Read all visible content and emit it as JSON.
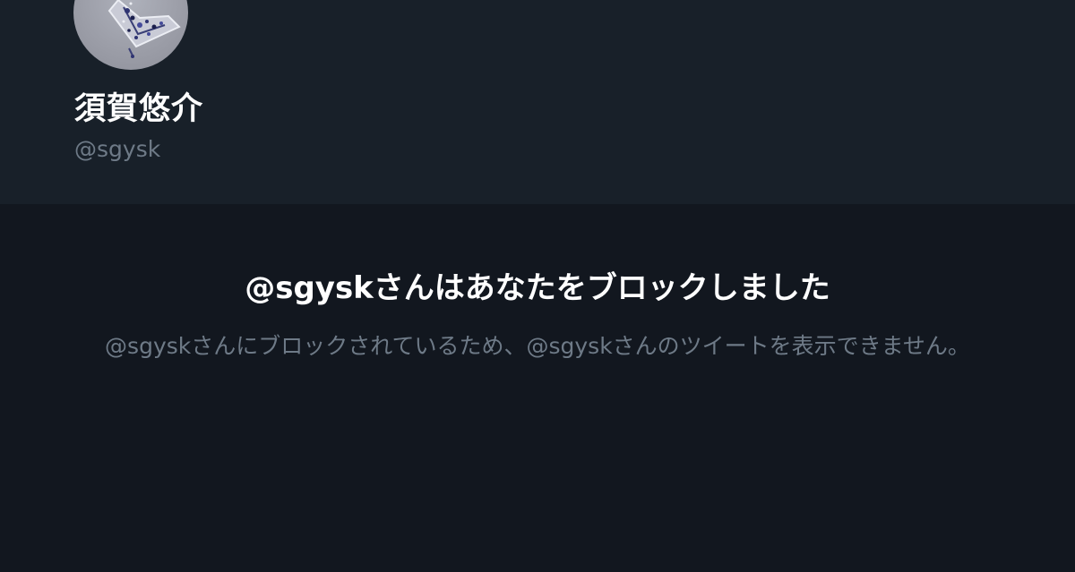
{
  "profile": {
    "display_name": "須賀悠介",
    "handle": "@sgysk",
    "avatar_icon": "avatar-image"
  },
  "blocked_notice": {
    "title": "@sgyskさんはあなたをブロックしました",
    "description": "@sgyskさんにブロックされているため、@sgyskさんのツイートを表示できません。"
  },
  "colors": {
    "header_background": "#182029",
    "page_background": "#12171f",
    "primary_text": "#ffffff",
    "secondary_text": "#6e7a87"
  }
}
